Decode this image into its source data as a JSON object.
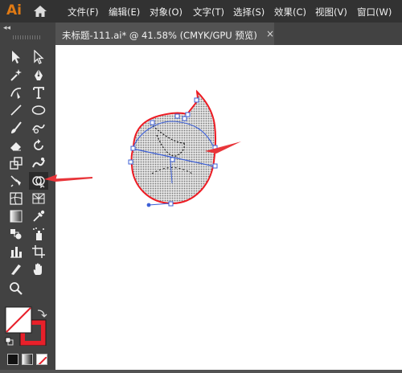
{
  "app": {
    "logo_text": "Ai"
  },
  "menu": [
    {
      "label": "文件(F)"
    },
    {
      "label": "编辑(E)"
    },
    {
      "label": "对象(O)"
    },
    {
      "label": "文字(T)"
    },
    {
      "label": "选择(S)"
    },
    {
      "label": "效果(C)"
    },
    {
      "label": "视图(V)"
    },
    {
      "label": "窗口(W)"
    }
  ],
  "document_tab": {
    "title": "未标题-111.ai* @ 41.58% (CMYK/GPU 预览)",
    "close_glyph": "×"
  },
  "toolbar": {
    "collapse_glyph": "◂◂",
    "tools": [
      {
        "name": "selection-tool-icon"
      },
      {
        "name": "direct-selection-tool-icon"
      },
      {
        "name": "magic-wand-tool-icon"
      },
      {
        "name": "pen-tool-icon"
      },
      {
        "name": "curvature-tool-icon"
      },
      {
        "name": "type-tool-icon"
      },
      {
        "name": "line-segment-tool-icon"
      },
      {
        "name": "ellipse-tool-icon"
      },
      {
        "name": "paintbrush-tool-icon"
      },
      {
        "name": "shaper-tool-icon"
      },
      {
        "name": "eraser-tool-icon"
      },
      {
        "name": "rotate-tool-icon"
      },
      {
        "name": "scale-tool-icon"
      },
      {
        "name": "puppet-warp-tool-icon"
      },
      {
        "name": "free-transform-tool-icon"
      },
      {
        "name": "shape-builder-tool-icon"
      },
      {
        "name": "mesh-tool-icon"
      },
      {
        "name": "perspective-grid-tool-icon"
      },
      {
        "name": "gradient-tool-icon"
      },
      {
        "name": "eyedropper-tool-icon"
      },
      {
        "name": "blend-tool-icon"
      },
      {
        "name": "symbol-sprayer-tool-icon"
      },
      {
        "name": "column-graph-tool-icon"
      },
      {
        "name": "artboard-tool-icon"
      },
      {
        "name": "slice-tool-icon"
      },
      {
        "name": "hand-tool-icon"
      },
      {
        "name": "zoom-tool-icon"
      }
    ],
    "active_tool": "shape-builder-tool-icon"
  },
  "colors": {
    "fill": "#ffffff",
    "stroke": "#e8202a",
    "annotation_arrow": "#e8353a",
    "path_selection": "#3c5fd6",
    "shape_fill": "#cfcfcf",
    "shape_outline": "#ee1c24"
  }
}
